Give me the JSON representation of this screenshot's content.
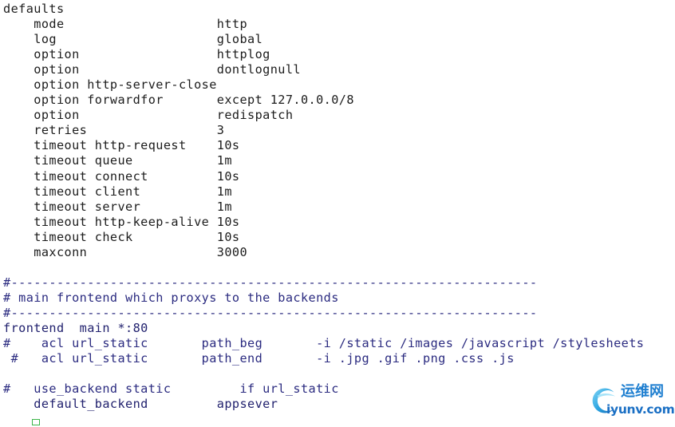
{
  "document": {
    "kind": "haproxy-config-text",
    "background_color": "#ffffff",
    "plain_text_color": "#1c1c1c",
    "comment_text_color": "#2b2b80",
    "keyword_text_color": "#21216e"
  },
  "lines": [
    {
      "id": "line-defaults",
      "text": "defaults",
      "role": "plain"
    },
    {
      "id": "line-mode",
      "text": "    mode                    http",
      "role": "plain"
    },
    {
      "id": "line-log",
      "text": "    log                     global",
      "role": "plain"
    },
    {
      "id": "line-option-httplog",
      "text": "    option                  httplog",
      "role": "plain"
    },
    {
      "id": "line-option-dontlognull",
      "text": "    option                  dontlognull",
      "role": "plain"
    },
    {
      "id": "line-option-http-server-close",
      "text": "    option http-server-close",
      "role": "plain"
    },
    {
      "id": "line-option-forwardfor",
      "text": "    option forwardfor       except 127.0.0.0/8",
      "role": "plain"
    },
    {
      "id": "line-option-redispatch",
      "text": "    option                  redispatch",
      "role": "plain"
    },
    {
      "id": "line-retries",
      "text": "    retries                 3",
      "role": "plain"
    },
    {
      "id": "line-timeout-http-request",
      "text": "    timeout http-request    10s",
      "role": "plain"
    },
    {
      "id": "line-timeout-queue",
      "text": "    timeout queue           1m",
      "role": "plain"
    },
    {
      "id": "line-timeout-connect",
      "text": "    timeout connect         10s",
      "role": "plain"
    },
    {
      "id": "line-timeout-client",
      "text": "    timeout client          1m",
      "role": "plain"
    },
    {
      "id": "line-timeout-server",
      "text": "    timeout server          1m",
      "role": "plain"
    },
    {
      "id": "line-timeout-http-keep-alive",
      "text": "    timeout http-keep-alive 10s",
      "role": "plain"
    },
    {
      "id": "line-timeout-check",
      "text": "    timeout check           10s",
      "role": "plain"
    },
    {
      "id": "line-maxconn",
      "text": "    maxconn                 3000",
      "role": "plain"
    },
    {
      "id": "line-blank-1",
      "text": "",
      "role": "plain"
    },
    {
      "id": "line-rule-top",
      "text": "#---------------------------------------------------------------------",
      "role": "comment"
    },
    {
      "id": "line-section-comment",
      "text": "# main frontend which proxys to the backends",
      "role": "comment"
    },
    {
      "id": "line-rule-bottom",
      "text": "#---------------------------------------------------------------------",
      "role": "comment"
    },
    {
      "id": "line-frontend-main",
      "text": "frontend  main *:80",
      "role": "keyword"
    },
    {
      "id": "line-acl-url-static-beg",
      "text": "#    acl url_static       path_beg       -i /static /images /javascript /stylesheets",
      "role": "comment"
    },
    {
      "id": "line-acl-url-static-end",
      "text": " #   acl url_static       path_end       -i .jpg .gif .png .css .js",
      "role": "comment"
    },
    {
      "id": "line-blank-2",
      "text": "",
      "role": "plain"
    },
    {
      "id": "line-use-backend-static",
      "text": "#   use_backend static         if url_static",
      "role": "comment"
    },
    {
      "id": "line-default-backend",
      "text": "    default_backend         appsever",
      "role": "keyword"
    }
  ],
  "cursor": {
    "label": "terminal-cursor",
    "color": "#3cb54a"
  },
  "watermark": {
    "chinese_text": "运维网",
    "domain_text": "iyunv.com",
    "brand_color": "#1f7fd0"
  }
}
